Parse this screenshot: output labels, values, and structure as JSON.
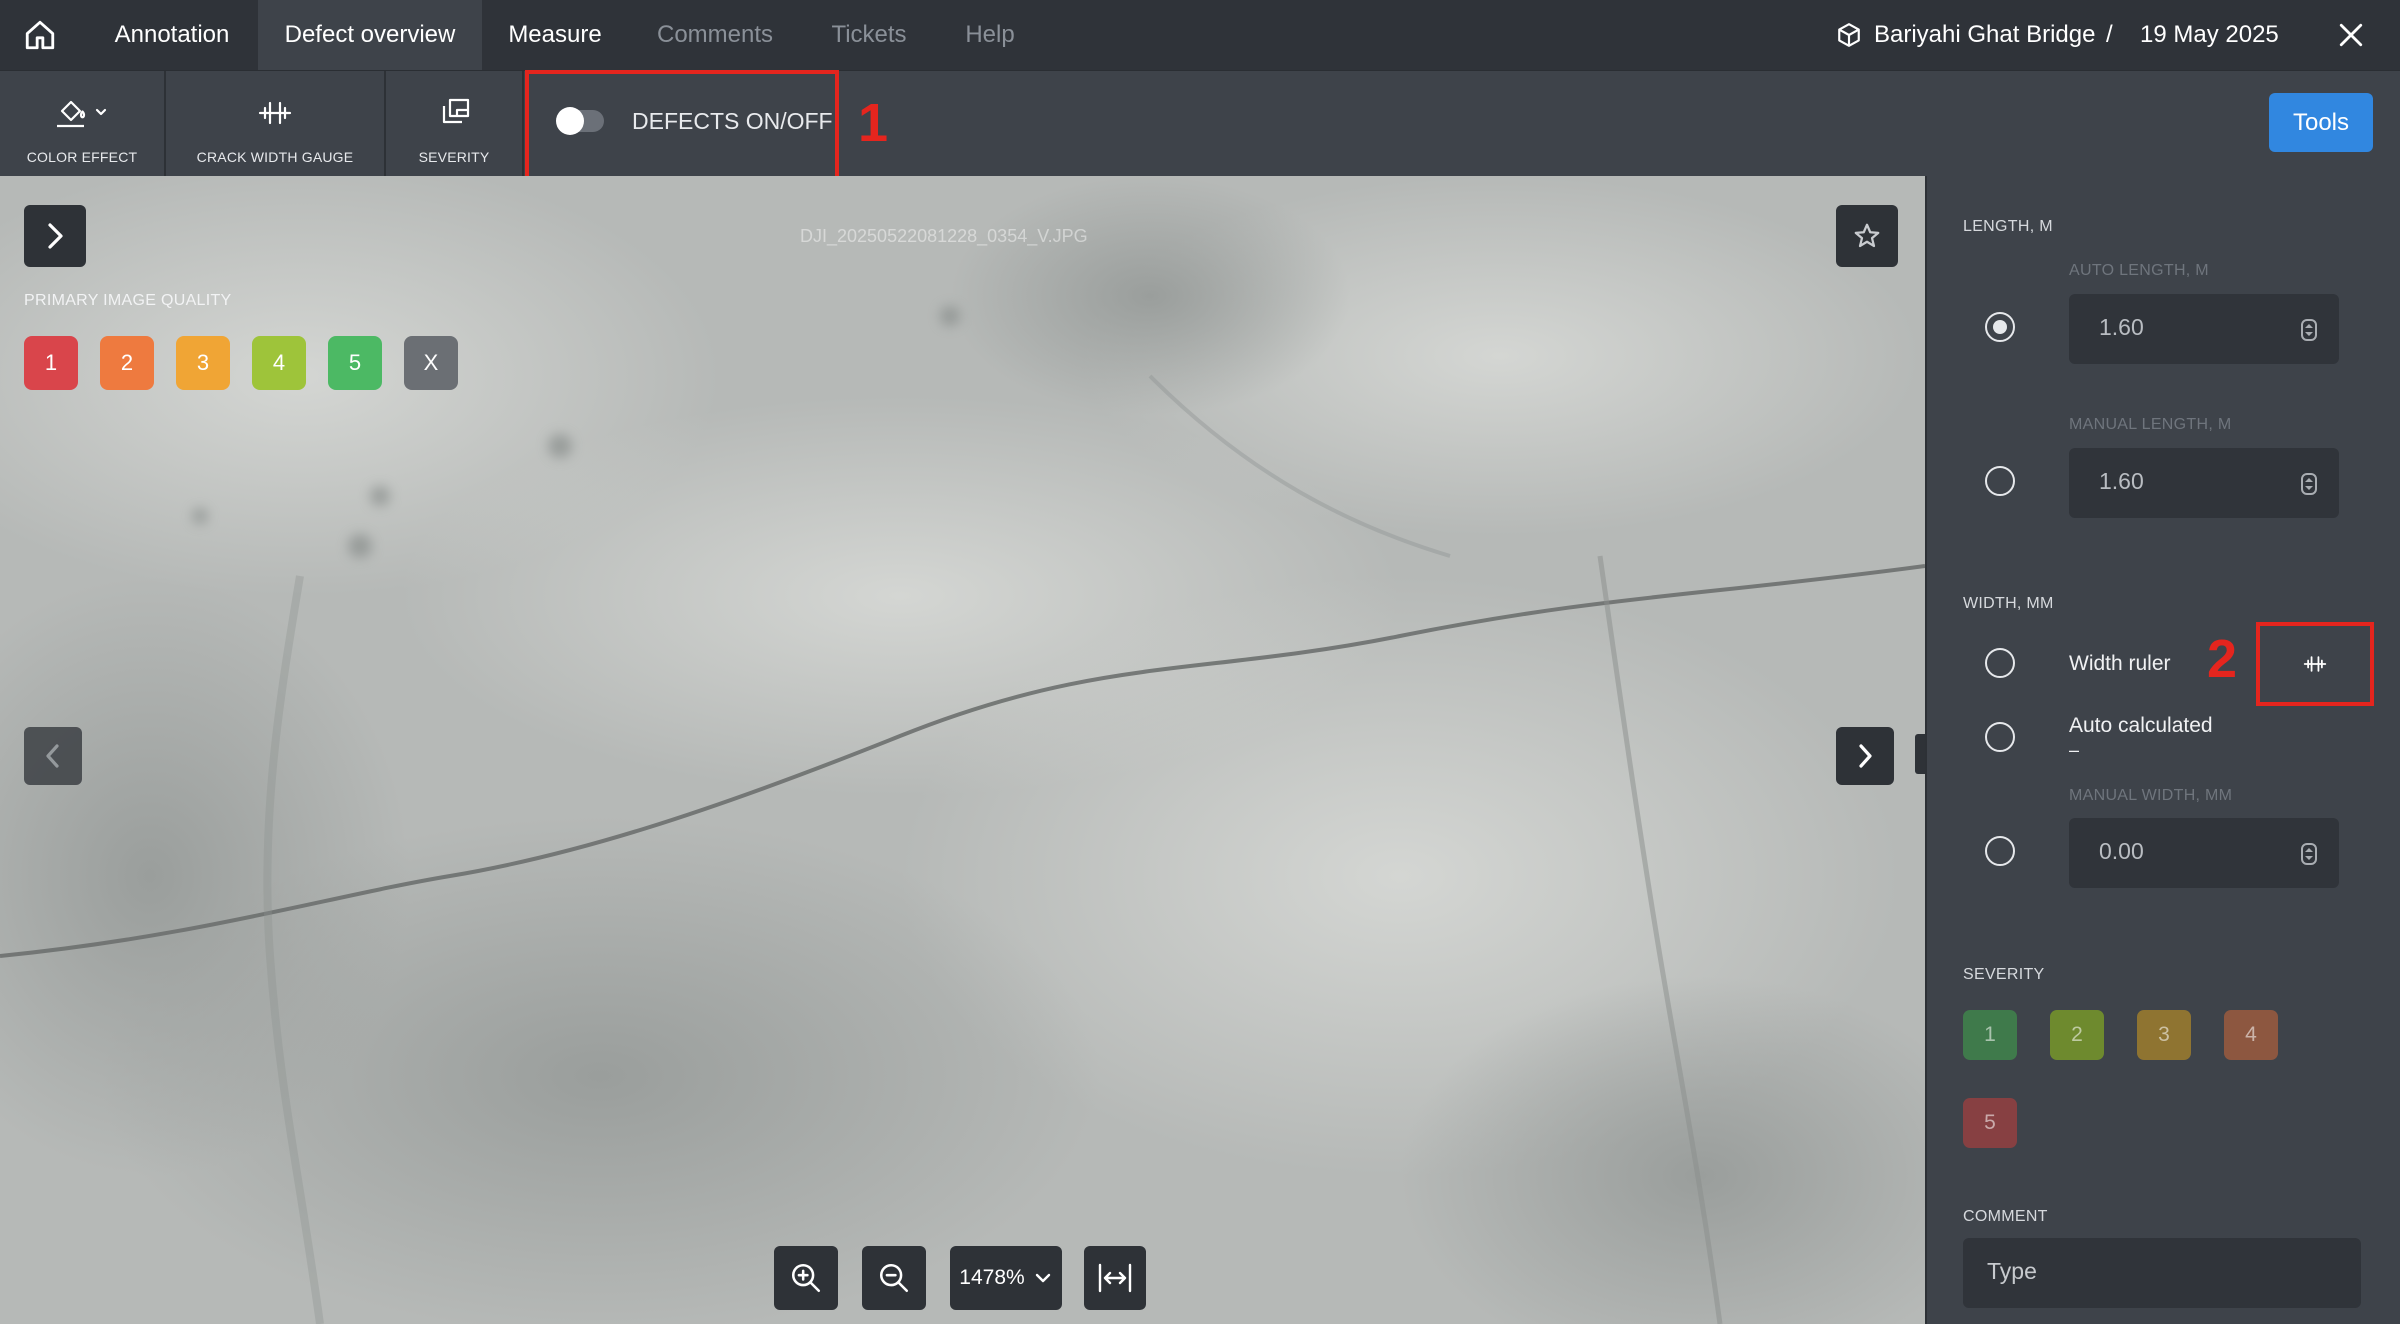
{
  "nav": {
    "home_icon": "home-icon",
    "tabs": [
      {
        "label": "Annotation",
        "state": "normal"
      },
      {
        "label": "Defect overview",
        "state": "active"
      },
      {
        "label": "Measure",
        "state": "normal"
      },
      {
        "label": "Comments",
        "state": "disabled"
      },
      {
        "label": "Tickets",
        "state": "disabled"
      },
      {
        "label": "Help",
        "state": "disabled"
      }
    ],
    "structure": "Bariyahi Ghat Bridge",
    "separator": "/",
    "date": "19 May 2025",
    "close_icon": "close-icon"
  },
  "toolbar": {
    "color_effect": "COLOR EFFECT",
    "crack_width_gauge": "CRACK WIDTH GAUGE",
    "severity": "SEVERITY",
    "defects_toggle": "DEFECTS ON/OFF",
    "defects_on": false,
    "tools": "Tools"
  },
  "annotations": {
    "marker1": "1",
    "marker2": "2"
  },
  "viewer": {
    "filename": "DJI_20250522081228_0354_V.JPG",
    "image_quality_label": "PRIMARY IMAGE QUALITY",
    "quality_buttons": [
      {
        "label": "1",
        "color": "#d9454b"
      },
      {
        "label": "2",
        "color": "#ee7a3f"
      },
      {
        "label": "3",
        "color": "#f0a535"
      },
      {
        "label": "4",
        "color": "#9ec43a"
      },
      {
        "label": "5",
        "color": "#4cb964"
      },
      {
        "label": "X",
        "color": "#6b6f74"
      }
    ],
    "zoom": "1478%"
  },
  "panel": {
    "length_label": "LENGTH, M",
    "auto_length_label": "AUTO LENGTH, M",
    "auto_length_value": "1.60",
    "manual_length_label": "MANUAL LENGTH, M",
    "manual_length_value": "1.60",
    "width_label": "WIDTH, MM",
    "width_ruler": "Width ruler",
    "auto_calculated": "Auto calculated",
    "auto_calculated_value": "–",
    "manual_width_label": "MANUAL WIDTH, MM",
    "manual_width_value": "0.00",
    "severity_label": "SEVERITY",
    "severity_buttons": [
      {
        "label": "1",
        "color": "#3f7a4b"
      },
      {
        "label": "2",
        "color": "#6e8a2e"
      },
      {
        "label": "3",
        "color": "#8f7431"
      },
      {
        "label": "4",
        "color": "#8d5740"
      },
      {
        "label": "5",
        "color": "#874042"
      }
    ],
    "comment_label": "COMMENT",
    "comment_placeholder": "Type"
  }
}
